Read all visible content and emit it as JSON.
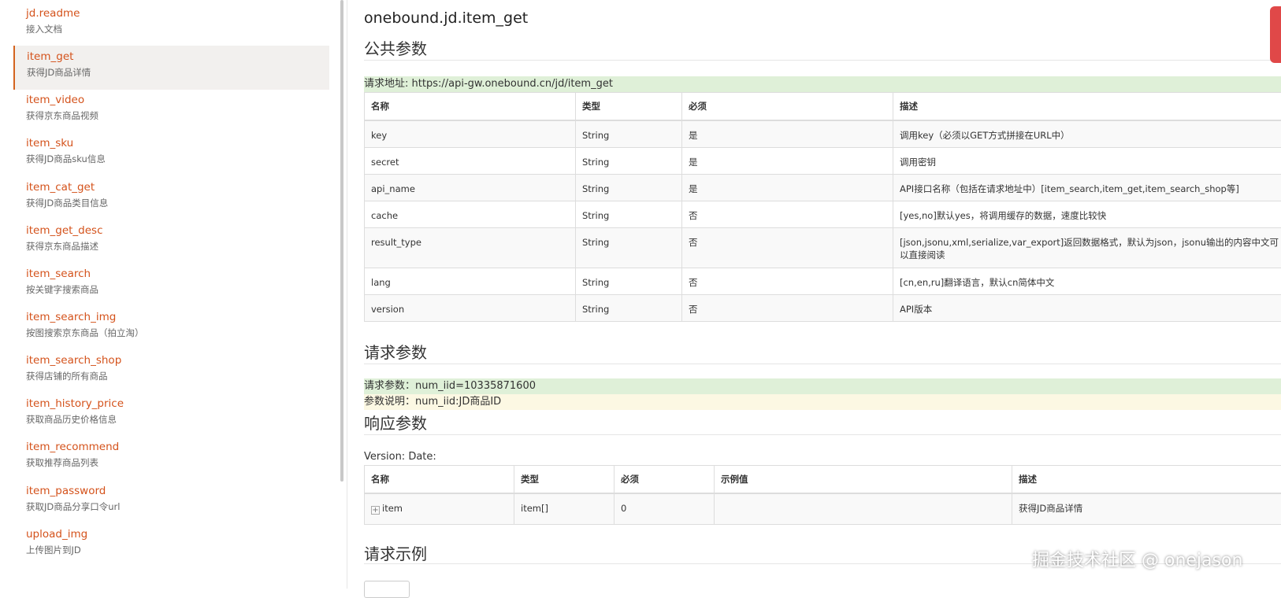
{
  "sidebar": {
    "items": [
      {
        "name": "jd.readme",
        "desc": "接入文档"
      },
      {
        "name": "item_get",
        "desc": "获得JD商品详情"
      },
      {
        "name": "item_video",
        "desc": "获得京东商品视频"
      },
      {
        "name": "item_sku",
        "desc": "获得JD商品sku信息"
      },
      {
        "name": "item_cat_get",
        "desc": "获得JD商品类目信息"
      },
      {
        "name": "item_get_desc",
        "desc": "获得京东商品描述"
      },
      {
        "name": "item_search",
        "desc": "按关键字搜索商品"
      },
      {
        "name": "item_search_img",
        "desc": "按图搜索京东商品（拍立淘）"
      },
      {
        "name": "item_search_shop",
        "desc": "获得店铺的所有商品"
      },
      {
        "name": "item_history_price",
        "desc": "获取商品历史价格信息"
      },
      {
        "name": "item_recommend",
        "desc": "获取推荐商品列表"
      },
      {
        "name": "item_password",
        "desc": "获取JD商品分享口令url"
      },
      {
        "name": "upload_img",
        "desc": "上传图片到JD"
      }
    ]
  },
  "main": {
    "title": "onebound.jd.item_get",
    "public_params": {
      "heading": "公共参数",
      "request_url": "请求地址: https://api-gw.onebound.cn/jd/item_get",
      "headers": [
        "名称",
        "类型",
        "必须",
        "描述"
      ],
      "rows": [
        [
          "key",
          "String",
          "是",
          "调用key（必须以GET方式拼接在URL中）"
        ],
        [
          "secret",
          "String",
          "是",
          "调用密钥"
        ],
        [
          "api_name",
          "String",
          "是",
          "API接口名称（包括在请求地址中）[item_search,item_get,item_search_shop等]"
        ],
        [
          "cache",
          "String",
          "否",
          "[yes,no]默认yes，将调用缓存的数据，速度比较快"
        ],
        [
          "result_type",
          "String",
          "否",
          "[json,jsonu,xml,serialize,var_export]返回数据格式，默认为json，jsonu输出的内容中文可以直接阅读"
        ],
        [
          "lang",
          "String",
          "否",
          "[cn,en,ru]翻译语言，默认cn简体中文"
        ],
        [
          "version",
          "String",
          "否",
          "API版本"
        ]
      ]
    },
    "request_params": {
      "heading": "请求参数",
      "params": "请求参数：num_iid=10335871600",
      "explain": "参数说明：num_iid:JD商品ID"
    },
    "response_params": {
      "heading": "响应参数",
      "version": "Version: Date:",
      "headers": [
        "名称",
        "类型",
        "必须",
        "示例值",
        "描述"
      ],
      "rows": [
        [
          "item",
          "item[]",
          "0",
          "",
          "获得JD商品详情"
        ]
      ]
    },
    "request_example": {
      "heading": "请求示例"
    }
  },
  "watermark": "掘金技术社区 @ onejason"
}
